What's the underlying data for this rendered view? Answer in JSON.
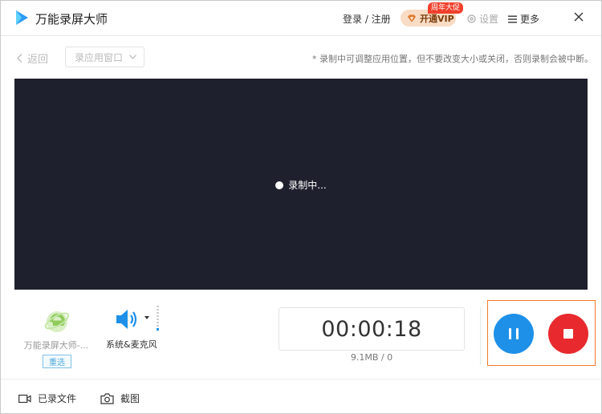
{
  "window": {
    "title": "万能录屏大师",
    "login_label": "登录 / 注册",
    "vip_label": "开通VIP",
    "vip_badge": "周年大促",
    "settings_label": "设置",
    "more_label": "更多"
  },
  "toolbar": {
    "back_label": "返回",
    "window_select_value": "录应用窗口",
    "notice": "* 录制中可调整应用位置，但不要改变大小或关闭，否则录制会被中断。"
  },
  "preview": {
    "status": "录制中..."
  },
  "source": {
    "app_name": "万能录屏大师-...",
    "reselect_label": "重选",
    "audio_label": "系统&麦克风"
  },
  "recording": {
    "elapsed": "00:00:18",
    "size": "9.1MB / 0"
  },
  "footer": {
    "recorded_files_label": "已录文件",
    "screenshot_label": "截图"
  },
  "colors": {
    "preview_bg": "#1e202d",
    "pause": "#1e90e8",
    "stop": "#e8292d",
    "highlight_border": "#f07a2a",
    "vip_bg": "#f8dcc5"
  }
}
